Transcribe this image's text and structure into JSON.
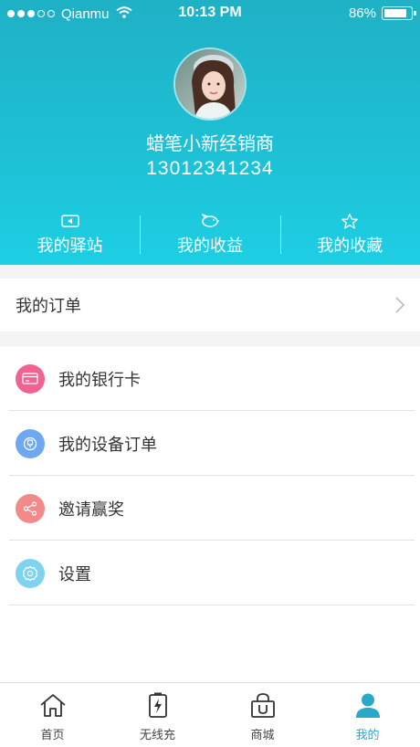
{
  "status_bar": {
    "carrier": "Qianmu",
    "time": "10:13 PM",
    "battery_percent": "86%",
    "battery_level": 0.86,
    "signal_bars_filled": 3,
    "signal_bars_total": 5
  },
  "profile": {
    "name": "蜡笔小新经销商",
    "phone": "13012341234"
  },
  "stats": [
    {
      "label": "我的驿站",
      "icon": "station-card-icon"
    },
    {
      "label": "我的收益",
      "icon": "piggy-bank-icon"
    },
    {
      "label": "我的收藏",
      "icon": "star-icon"
    }
  ],
  "orders": {
    "label": "我的订单"
  },
  "menu": [
    {
      "label": "我的银行卡",
      "icon": "bank-card-icon",
      "color": "#f06292"
    },
    {
      "label": "我的设备订单",
      "icon": "plug-icon",
      "color": "#6ea8f0"
    },
    {
      "label": "邀请赢奖",
      "icon": "share-icon",
      "color": "#f38a8a"
    },
    {
      "label": "设置",
      "icon": "settings-gear-icon",
      "color": "#7fd3ef"
    }
  ],
  "tabs": [
    {
      "label": "首页",
      "icon": "home-icon"
    },
    {
      "label": "无线充",
      "icon": "battery-charge-icon"
    },
    {
      "label": "商城",
      "icon": "shopping-bag-icon"
    },
    {
      "label": "我的",
      "icon": "user-icon",
      "active": true
    }
  ],
  "colors": {
    "accent": "#2aa7c9",
    "header_top": "#1fb1c6",
    "header_bottom": "#1dcfe4"
  }
}
